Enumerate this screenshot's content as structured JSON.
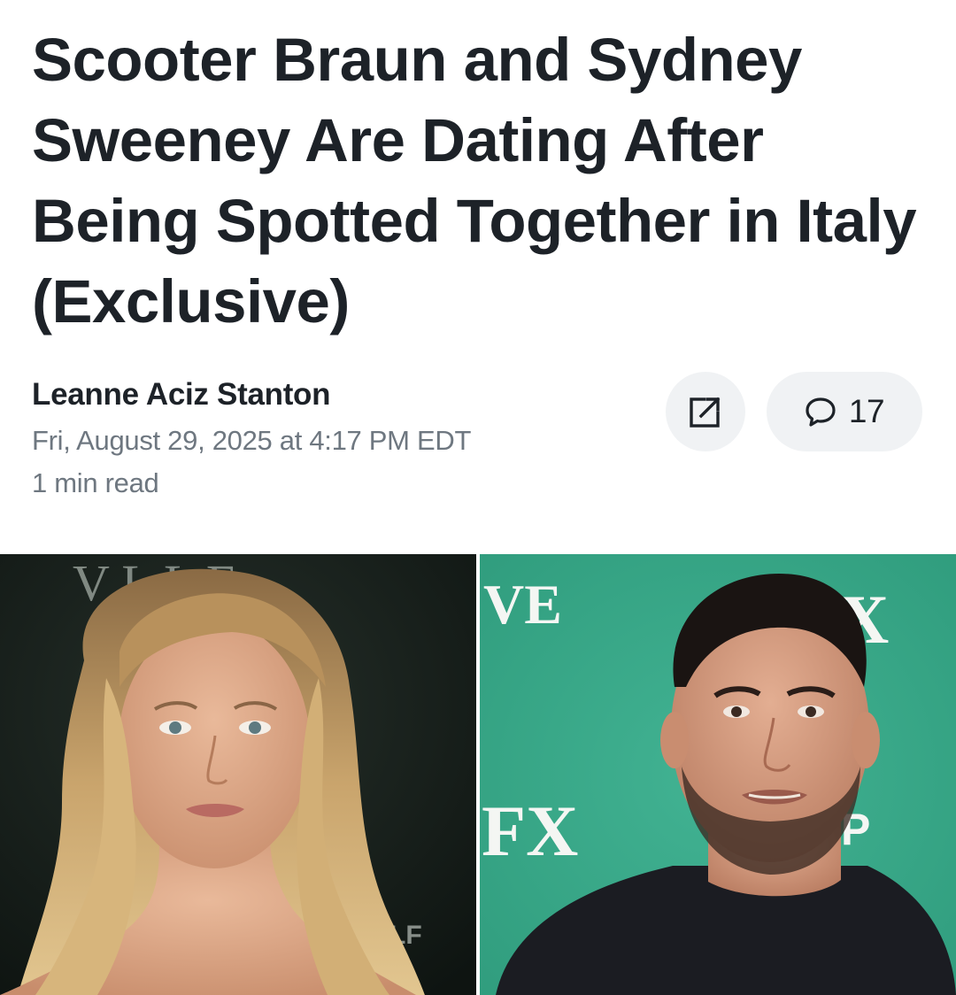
{
  "article": {
    "headline": "Scooter Braun and Sydney Sweeney Are Dating After Being Spotted Together in Italy (Exclusive)",
    "author": "Leanne Aciz Stanton",
    "date": "Fri, August 29, 2025 at 4:17 PM EDT",
    "read_time": "1 min read"
  },
  "actions": {
    "share_icon": "share-external-icon",
    "comment_icon": "comment-bubble-icon",
    "comment_count": "17"
  },
  "hero_image": {
    "left_backdrop_text": "V    L L E",
    "left_backdrop_small_text": "LF",
    "right_backdrop_text_top": "VE",
    "right_backdrop_logo_mid": "FX",
    "right_backdrop_logo_top": "X",
    "right_backdrop_partial": "P",
    "colors": {
      "left_backdrop": "#141c18",
      "right_backdrop": "#3aa889",
      "logo_white": "#f4f6f3"
    }
  }
}
